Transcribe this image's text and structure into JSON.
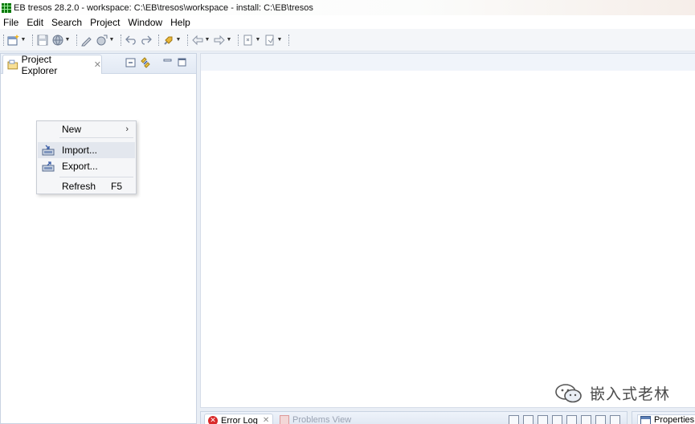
{
  "window": {
    "title": "EB tresos 28.2.0 - workspace: C:\\EB\\tresos\\workspace - install: C:\\EB\\tresos"
  },
  "menubar": {
    "items": [
      "File",
      "Edit",
      "Search",
      "Project",
      "Window",
      "Help"
    ]
  },
  "toolbar": {
    "icons": [
      "new-wizard-icon",
      "save-icon",
      "globe-icon",
      "edit-icon",
      "run-icon",
      "back-nav-icon",
      "forward-nav-icon",
      "launch-icon",
      "back-arrow-icon",
      "forward-arrow-icon",
      "annotation-icon",
      "annotation-next-icon"
    ]
  },
  "project_explorer": {
    "tab_label": "Project Explorer"
  },
  "context_menu": {
    "items": [
      {
        "label": "New",
        "has_submenu": true
      },
      {
        "label": "Import...",
        "icon": "import-icon"
      },
      {
        "label": "Export...",
        "icon": "export-icon"
      },
      {
        "label": "Refresh",
        "accelerator": "F5"
      }
    ]
  },
  "bottom_panel": {
    "tabs": [
      {
        "label": "Error Log"
      },
      {
        "label": "Problems View"
      }
    ]
  },
  "properties_panel": {
    "tab_label": "Properties"
  },
  "watermark": {
    "text": "嵌入式老林"
  },
  "colors": {
    "accent": "#2a5fa8",
    "panel_border": "#c9d3e2",
    "error": "#d92a2a"
  }
}
